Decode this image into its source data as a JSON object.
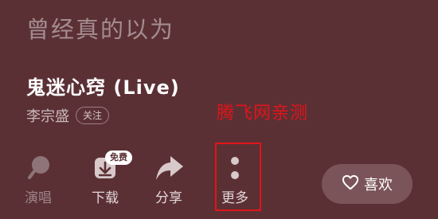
{
  "lyric": {
    "current_line": "曾经真的以为"
  },
  "song": {
    "title": "鬼迷心窍 (Live)",
    "artist": "李宗盛",
    "follow_label": "关注"
  },
  "watermark": {
    "text": "腾飞网亲测"
  },
  "actions": {
    "karaoke_label": "演唱",
    "download_label": "下载",
    "download_badge": "免费",
    "share_label": "分享",
    "more_label": "更多"
  },
  "like": {
    "label": "喜欢"
  },
  "colors": {
    "background": "#5b3035",
    "highlight": "#e0141a"
  }
}
